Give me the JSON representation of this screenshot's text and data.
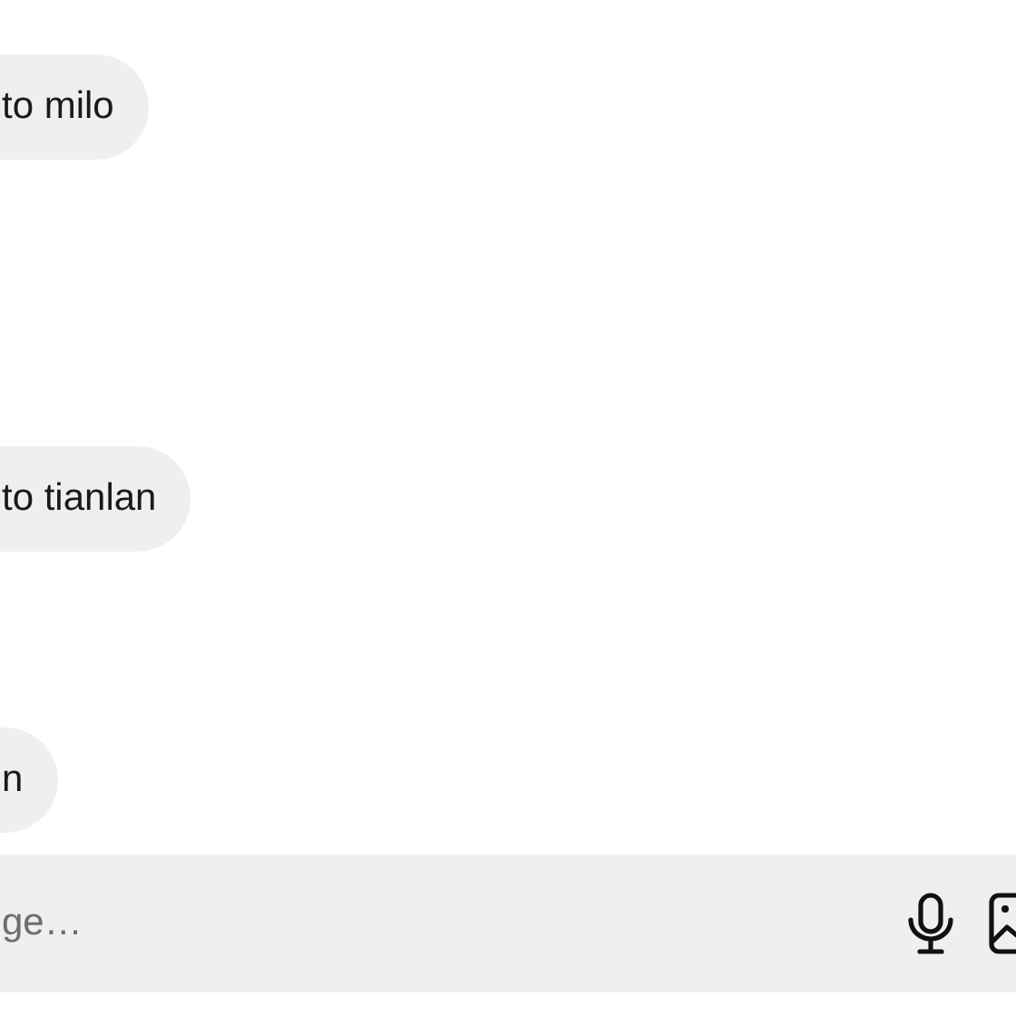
{
  "messages": [
    {
      "text": "to milo"
    },
    {
      "text": "to tianlan"
    },
    {
      "text": "n"
    }
  ],
  "composer": {
    "placeholder": "ge…"
  }
}
